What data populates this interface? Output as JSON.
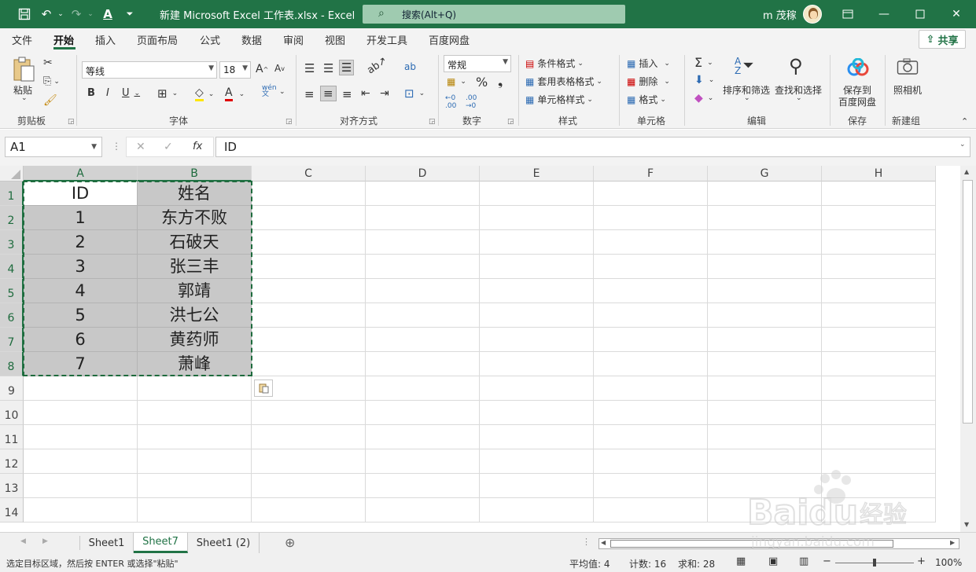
{
  "titlebar": {
    "title": "新建 Microsoft Excel 工作表.xlsx  -  Excel",
    "search_placeholder": "搜索(Alt+Q)",
    "user": "m 茂稼"
  },
  "menu": [
    "文件",
    "开始",
    "插入",
    "页面布局",
    "公式",
    "数据",
    "审阅",
    "视图",
    "开发工具",
    "百度网盘"
  ],
  "share_label": "共享",
  "ribbon": {
    "clipboard": {
      "paste": "粘贴",
      "group": "剪贴板"
    },
    "font": {
      "name": "等线",
      "size": "18",
      "group": "字体"
    },
    "alignment": {
      "group": "对齐方式"
    },
    "number": {
      "format": "常规",
      "group": "数字"
    },
    "styles": {
      "conditional": "条件格式",
      "table": "套用表格格式",
      "cell": "单元格样式",
      "group": "样式"
    },
    "cells": {
      "insert": "插入",
      "delete": "删除",
      "format": "格式",
      "group": "单元格"
    },
    "editing": {
      "sort": "排序和筛选",
      "find": "查找和选择",
      "group": "编辑"
    },
    "save": {
      "label1": "保存到",
      "label2": "百度网盘",
      "group": "保存"
    },
    "camera": {
      "label": "照相机",
      "group": "新建组"
    }
  },
  "formula_bar": {
    "name_box": "A1",
    "content": "ID"
  },
  "columns": [
    "A",
    "B",
    "C",
    "D",
    "E",
    "F",
    "G",
    "H"
  ],
  "rows": [
    "1",
    "2",
    "3",
    "4",
    "5",
    "6",
    "7",
    "8",
    "9",
    "10",
    "11",
    "12",
    "13",
    "14"
  ],
  "table": [
    [
      "ID",
      "姓名"
    ],
    [
      "1",
      "东方不败"
    ],
    [
      "2",
      "石破天"
    ],
    [
      "3",
      "张三丰"
    ],
    [
      "4",
      "郭靖"
    ],
    [
      "5",
      "洪七公"
    ],
    [
      "6",
      "黄药师"
    ],
    [
      "7",
      "萧峰"
    ]
  ],
  "sheets": [
    "Sheet1",
    "Sheet7",
    "Sheet1 (2)"
  ],
  "active_sheet": "Sheet7",
  "status": {
    "message": "选定目标区域，然后按 ENTER 或选择\"粘贴\"",
    "average": "平均值: 4",
    "count": "计数: 16",
    "sum": "求和: 28",
    "zoom": "100%"
  },
  "colors": {
    "accent": "#217346",
    "selection": "#c8c8c8"
  }
}
